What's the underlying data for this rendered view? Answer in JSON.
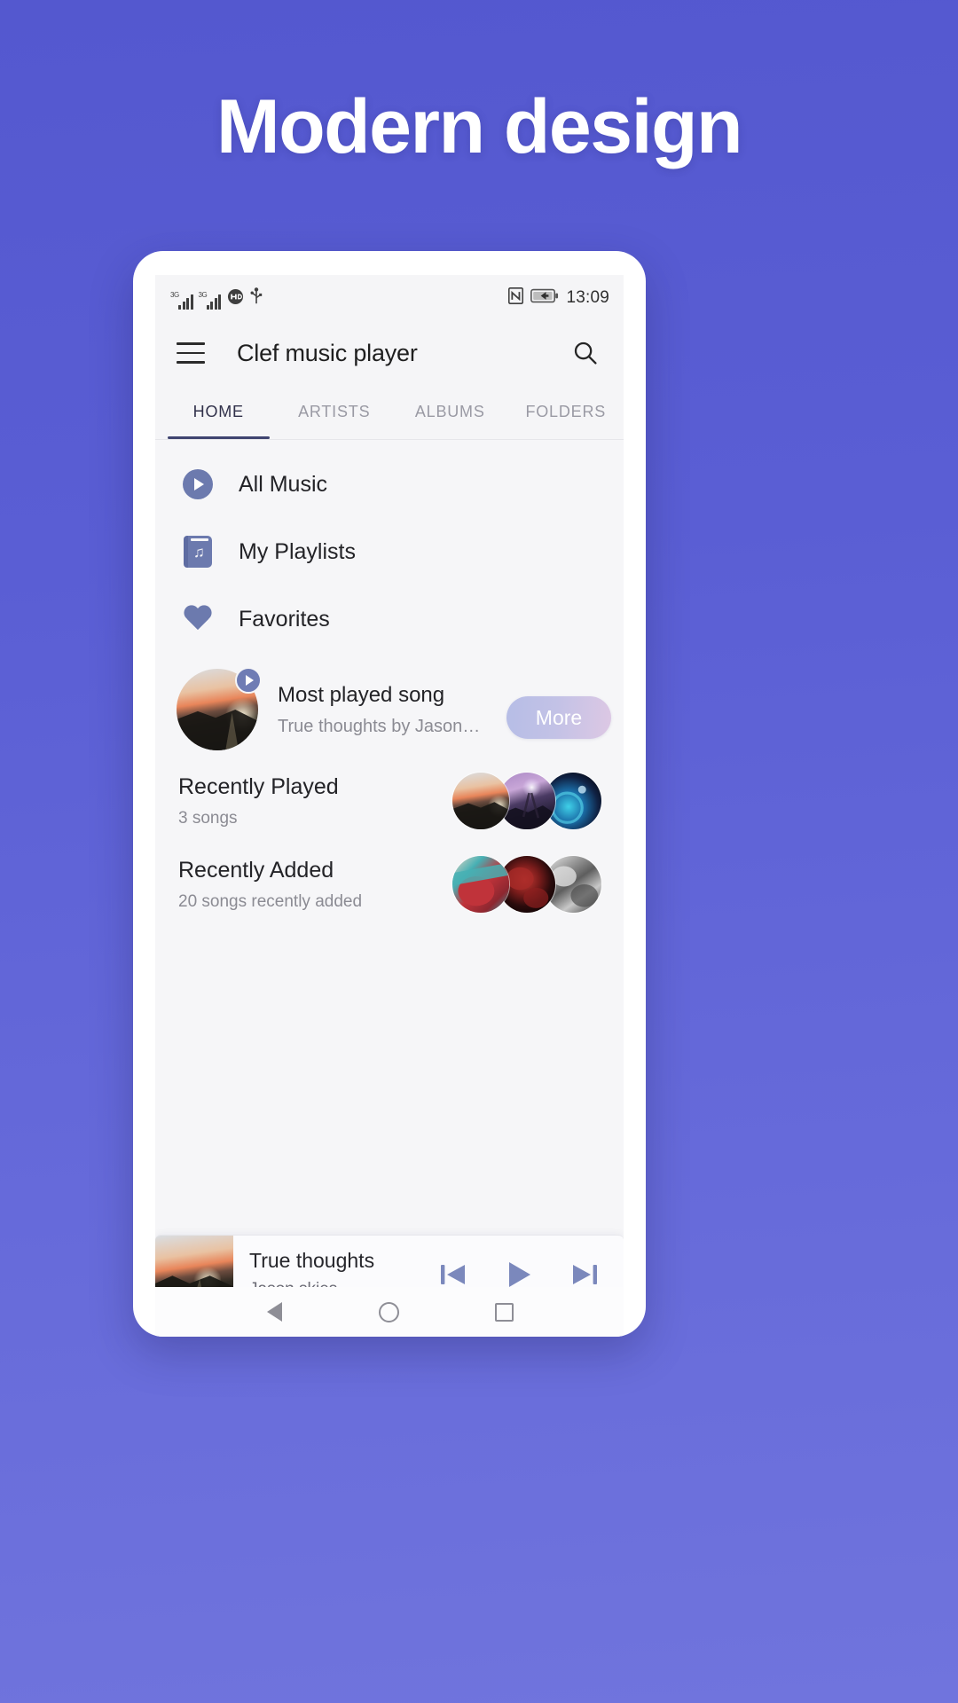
{
  "promo": {
    "headline": "Modern design",
    "background_color": "#5a5ed4"
  },
  "status_bar": {
    "network_label_1": "3G",
    "network_label_2": "3G",
    "icons": [
      "signal-3g-icon",
      "signal-3g-icon",
      "hd-audio-icon",
      "usb-icon",
      "nfc-icon",
      "battery-charging-icon"
    ],
    "clock": "13:09"
  },
  "app_bar": {
    "menu_icon": "hamburger-menu-icon",
    "title": "Clef music player",
    "search_icon": "search-icon"
  },
  "tabs": {
    "active_index": 0,
    "items": [
      {
        "label": "HOME"
      },
      {
        "label": "ARTISTS"
      },
      {
        "label": "ALBUMS"
      },
      {
        "label": "FOLDERS"
      }
    ],
    "indicator_color": "#3f4470"
  },
  "nav_list": {
    "icon_color": "#6c7aae",
    "items": [
      {
        "label": "All Music",
        "icon": "play-circle-icon"
      },
      {
        "label": "My Playlists",
        "icon": "playlist-book-icon"
      },
      {
        "label": "Favorites",
        "icon": "heart-icon"
      }
    ]
  },
  "most_played": {
    "title": "Most played song",
    "subtitle": "True thoughts by Jason…",
    "badge_icon": "play-badge-icon",
    "more_label": "More",
    "artwork": "sunset-artwork"
  },
  "sections": [
    {
      "title": "Recently Played",
      "subtitle": "3 songs",
      "thumbnails": [
        "sunset-artwork",
        "purple-nebula-artwork",
        "blue-cosmic-artwork"
      ]
    },
    {
      "title": "Recently Added",
      "subtitle": "20 songs recently added",
      "thumbnails": [
        "red-teal-artwork",
        "dark-red-artwork",
        "grayscale-artwork"
      ]
    }
  ],
  "mini_player": {
    "artwork": "sunset-artwork",
    "track_title": "True thoughts",
    "artist": "Jason skies",
    "controls": [
      {
        "name": "previous-button",
        "icon": "skip-previous-icon"
      },
      {
        "name": "play-button",
        "icon": "play-icon"
      },
      {
        "name": "next-button",
        "icon": "skip-next-icon"
      }
    ],
    "control_color": "#7b88bc"
  },
  "system_nav": {
    "items": [
      {
        "name": "back-button",
        "icon": "back-triangle-icon"
      },
      {
        "name": "home-button",
        "icon": "home-circle-icon"
      },
      {
        "name": "recents-button",
        "icon": "recents-square-icon"
      }
    ]
  }
}
